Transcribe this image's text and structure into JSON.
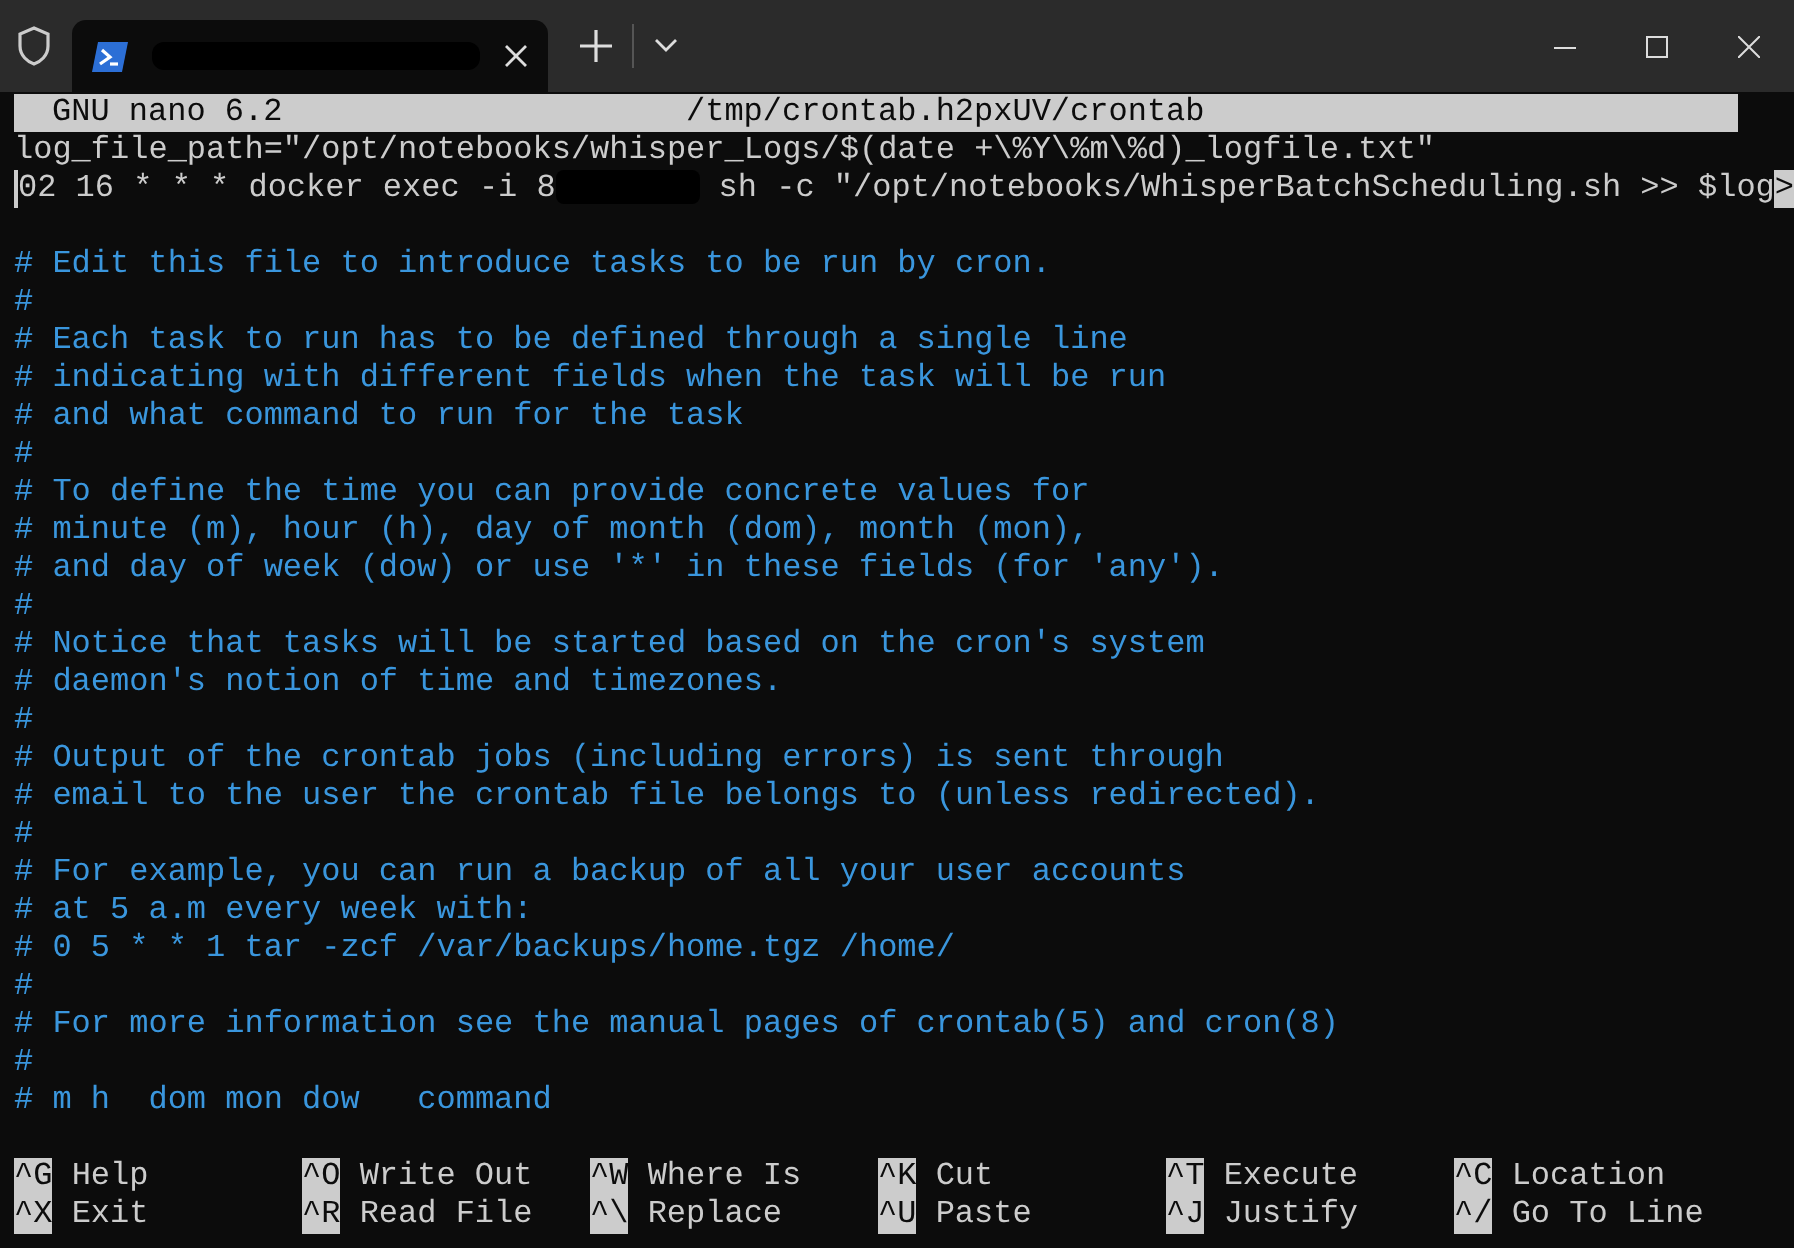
{
  "header": {
    "app": "GNU nano 6.2",
    "file": "/tmp/crontab.h2pxUV/crontab"
  },
  "lines": [
    {
      "kind": "text",
      "text": "log_file_path=\"/opt/notebooks/whisper_Logs/$(date +\\%Y\\%m\\%d)_logfile.txt\""
    },
    {
      "kind": "redacted",
      "before": "02 16 * * * docker exec -i 8",
      "after": " sh -c \"/opt/notebooks/WhisperBatchScheduling.sh >> $log",
      "overflow": ">"
    },
    {
      "kind": "blank"
    },
    {
      "kind": "comment",
      "text": "# Edit this file to introduce tasks to be run by cron."
    },
    {
      "kind": "comment",
      "text": "#"
    },
    {
      "kind": "comment",
      "text": "# Each task to run has to be defined through a single line"
    },
    {
      "kind": "comment",
      "text": "# indicating with different fields when the task will be run"
    },
    {
      "kind": "comment",
      "text": "# and what command to run for the task"
    },
    {
      "kind": "comment",
      "text": "#"
    },
    {
      "kind": "comment",
      "text": "# To define the time you can provide concrete values for"
    },
    {
      "kind": "comment",
      "text": "# minute (m), hour (h), day of month (dom), month (mon),"
    },
    {
      "kind": "comment",
      "text": "# and day of week (dow) or use '*' in these fields (for 'any')."
    },
    {
      "kind": "comment",
      "text": "#"
    },
    {
      "kind": "comment",
      "text": "# Notice that tasks will be started based on the cron's system"
    },
    {
      "kind": "comment",
      "text": "# daemon's notion of time and timezones."
    },
    {
      "kind": "comment",
      "text": "#"
    },
    {
      "kind": "comment",
      "text": "# Output of the crontab jobs (including errors) is sent through"
    },
    {
      "kind": "comment",
      "text": "# email to the user the crontab file belongs to (unless redirected)."
    },
    {
      "kind": "comment",
      "text": "#"
    },
    {
      "kind": "comment",
      "text": "# For example, you can run a backup of all your user accounts"
    },
    {
      "kind": "comment",
      "text": "# at 5 a.m every week with:"
    },
    {
      "kind": "comment",
      "text": "# 0 5 * * 1 tar -zcf /var/backups/home.tgz /home/"
    },
    {
      "kind": "comment",
      "text": "#"
    },
    {
      "kind": "comment",
      "text": "# For more information see the manual pages of crontab(5) and cron(8)"
    },
    {
      "kind": "comment",
      "text": "#"
    },
    {
      "kind": "comment",
      "text": "# m h  dom mon dow   command"
    },
    {
      "kind": "blank"
    }
  ],
  "shortcuts": [
    [
      {
        "key": "^G",
        "label": "Help"
      },
      {
        "key": "^O",
        "label": "Write Out"
      },
      {
        "key": "^W",
        "label": "Where Is"
      },
      {
        "key": "^K",
        "label": "Cut"
      },
      {
        "key": "^T",
        "label": "Execute"
      },
      {
        "key": "^C",
        "label": "Location"
      }
    ],
    [
      {
        "key": "^X",
        "label": "Exit"
      },
      {
        "key": "^R",
        "label": "Read File"
      },
      {
        "key": "^\\",
        "label": "Replace"
      },
      {
        "key": "^U",
        "label": "Paste"
      },
      {
        "key": "^J",
        "label": "Justify"
      },
      {
        "key": "^/",
        "label": "Go To Line"
      }
    ]
  ]
}
